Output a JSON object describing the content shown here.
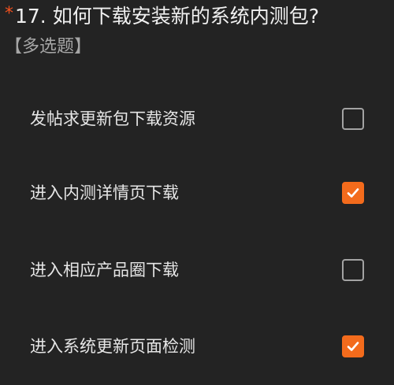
{
  "question": {
    "required_mark": "*",
    "title": "17. 如何下载安装新的系统内测包?",
    "type_label": "【多选题】"
  },
  "options": [
    {
      "label": "发帖求更新包下载资源",
      "checked": false
    },
    {
      "label": "进入内测详情页下载",
      "checked": true
    },
    {
      "label": "进入相应产品圈下载",
      "checked": false
    },
    {
      "label": "进入系统更新页面检测",
      "checked": true
    }
  ],
  "colors": {
    "background": "#232323",
    "accent": "#f36b1c",
    "required_mark": "#f4511e"
  },
  "icons": {
    "checked": "checkmark-icon"
  }
}
